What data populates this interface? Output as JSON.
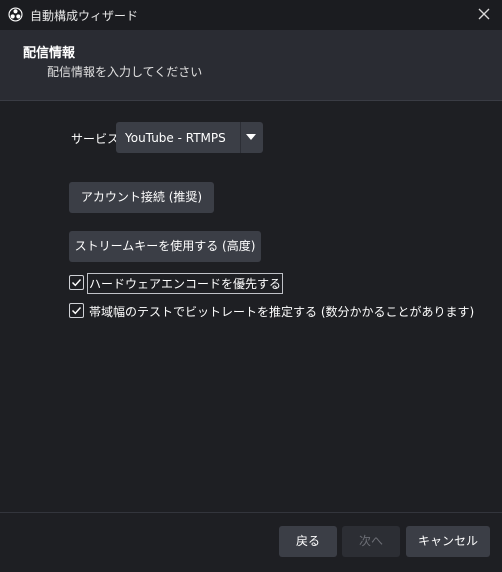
{
  "window": {
    "title": "自動構成ウィザード",
    "icon": "obs-icon",
    "close_icon": "close-icon"
  },
  "header": {
    "title": "配信情報",
    "subtitle": "配信情報を入力してください"
  },
  "service": {
    "label": "サービス",
    "selected": "YouTube - RTMPS"
  },
  "buttons": {
    "connect_account": "アカウント接続 (推奨)",
    "use_stream_key": "ストリームキーを使用する (高度)"
  },
  "checkboxes": [
    {
      "label": "ハードウェアエンコードを優先する",
      "checked": true
    },
    {
      "label": "帯域幅のテストでビットレートを推定する (数分かかることがあります)",
      "checked": true
    }
  ],
  "footer": {
    "back": "戻る",
    "next": "次へ",
    "cancel": "キャンセル"
  },
  "colors": {
    "background": "#1e1f23",
    "header_bg": "#2a2c33",
    "button_bg": "#3b3e46",
    "disabled_text": "#6c6e75"
  }
}
